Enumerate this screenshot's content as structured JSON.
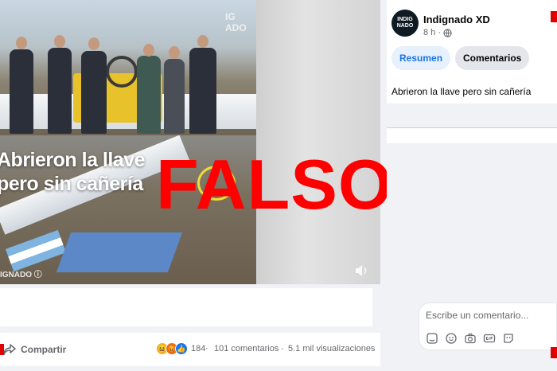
{
  "video": {
    "caption_line1": "Abrieron la llave",
    "caption_line2": "pero sin cañería",
    "watermark": "IGNADO ⓘ",
    "watermark_top": "IG\nADO",
    "overlay_label": "FALSO",
    "overlay_color": "#ff0000"
  },
  "action_bar": {
    "share_label": "Compartir",
    "reaction_count": "184",
    "comments": "101 comentarios",
    "separator": "·",
    "views": "5.1 mil visualizaciones",
    "reactions": [
      "haha-icon",
      "angry-icon",
      "like-icon"
    ]
  },
  "panel": {
    "avatar_line1": "INDIG",
    "avatar_line2": "NADO",
    "page_name": "Indignado XD",
    "post_time": "8 h ·",
    "tabs": [
      {
        "label": "Resumen",
        "active": true
      },
      {
        "label": "Comentarios",
        "active": false
      }
    ],
    "post_text": "Abrieron la llave pero sin cañería",
    "comment_placeholder": "Escribe un comentario..."
  },
  "colors": {
    "accent": "#1b74e4",
    "falso": "#ff0000",
    "background": "#f0f2f5"
  }
}
